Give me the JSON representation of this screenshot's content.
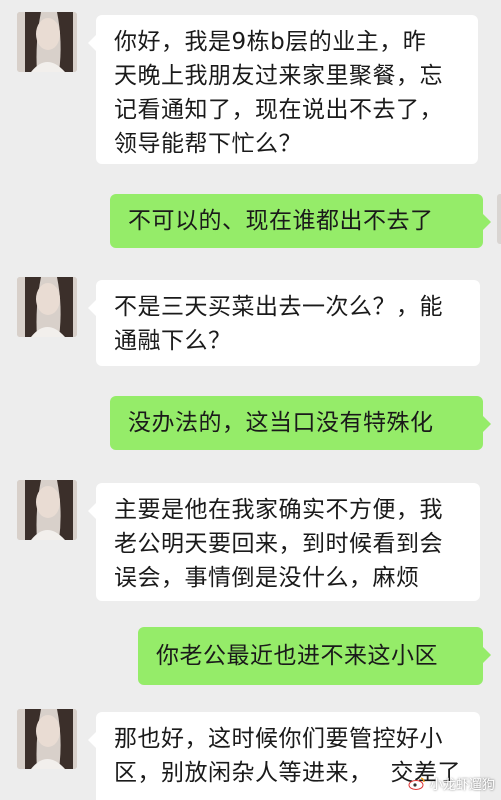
{
  "messages": [
    {
      "side": "left",
      "lines": [
        "你好，我是9栋b层的业主，昨",
        "天晚上我朋友过来家里聚餐，忘",
        "记看通知了，现在说出不去了，",
        "领导能帮下忙么？"
      ]
    },
    {
      "side": "right",
      "lines": [
        "不可以的、现在谁都出不去了"
      ]
    },
    {
      "side": "left",
      "lines": [
        "不是三天买菜出去一次么？，能",
        "通融下么？"
      ]
    },
    {
      "side": "right",
      "lines": [
        "没办法的，这当口没有特殊化"
      ]
    },
    {
      "side": "left",
      "lines": [
        "主要是他在我家确实不方便，我",
        "老公明天要回来，到时候看到会",
        "误会，事情倒是没什么，麻烦"
      ]
    },
    {
      "side": "right",
      "lines": [
        "你老公最近也进不来这小区"
      ]
    },
    {
      "side": "left",
      "lines": [
        "那也好，这时候你们要管控好小",
        "区，别放闲杂人等进来，",
        "交差了"
      ]
    }
  ],
  "watermark": {
    "text": "小龙虾遛狗",
    "icon": "weibo-icon"
  },
  "colors": {
    "background": "#ededed",
    "incoming_bubble": "#ffffff",
    "outgoing_bubble": "#95ec69"
  }
}
